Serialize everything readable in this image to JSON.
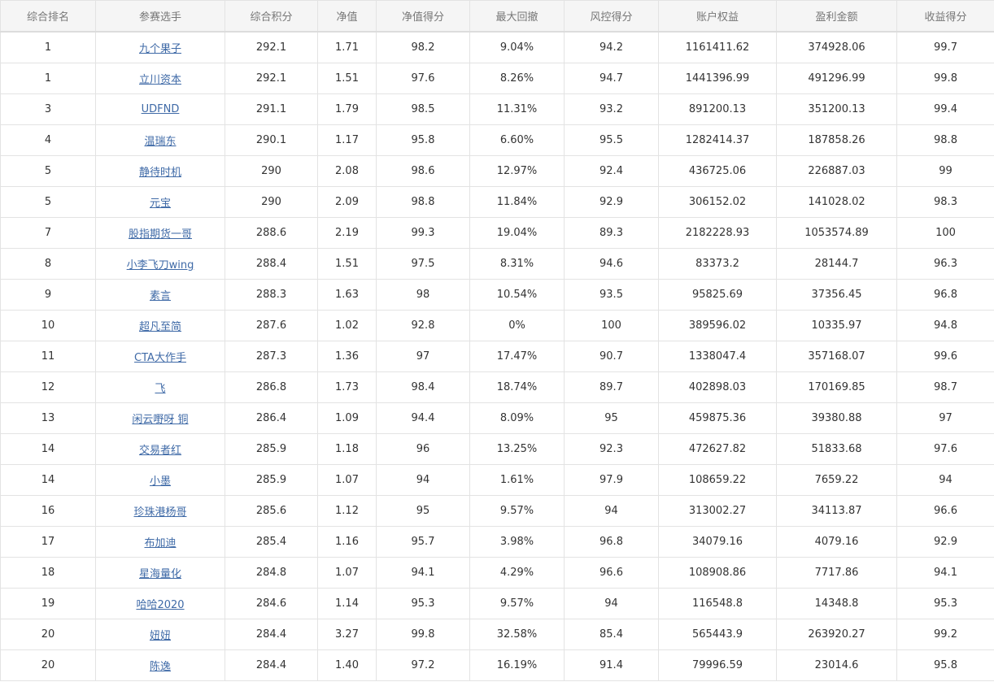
{
  "table": {
    "headers": [
      "综合排名",
      "参赛选手",
      "综合积分",
      "净值",
      "净值得分",
      "最大回撤",
      "风控得分",
      "账户权益",
      "盈利金额",
      "收益得分"
    ],
    "rows": [
      [
        "1",
        "九个果子",
        "292.1",
        "1.71",
        "98.2",
        "9.04%",
        "94.2",
        "1161411.62",
        "374928.06",
        "99.7"
      ],
      [
        "1",
        "立川资本",
        "292.1",
        "1.51",
        "97.6",
        "8.26%",
        "94.7",
        "1441396.99",
        "491296.99",
        "99.8"
      ],
      [
        "3",
        "UDFND",
        "291.1",
        "1.79",
        "98.5",
        "11.31%",
        "93.2",
        "891200.13",
        "351200.13",
        "99.4"
      ],
      [
        "4",
        "温瑞东",
        "290.1",
        "1.17",
        "95.8",
        "6.60%",
        "95.5",
        "1282414.37",
        "187858.26",
        "98.8"
      ],
      [
        "5",
        "静待时机",
        "290",
        "2.08",
        "98.6",
        "12.97%",
        "92.4",
        "436725.06",
        "226887.03",
        "99"
      ],
      [
        "5",
        "元宝",
        "290",
        "2.09",
        "98.8",
        "11.84%",
        "92.9",
        "306152.02",
        "141028.02",
        "98.3"
      ],
      [
        "7",
        "股指期货一哥",
        "288.6",
        "2.19",
        "99.3",
        "19.04%",
        "89.3",
        "2182228.93",
        "1053574.89",
        "100"
      ],
      [
        "8",
        "小李飞刀wing",
        "288.4",
        "1.51",
        "97.5",
        "8.31%",
        "94.6",
        "83373.2",
        "28144.7",
        "96.3"
      ],
      [
        "9",
        "素言",
        "288.3",
        "1.63",
        "98",
        "10.54%",
        "93.5",
        "95825.69",
        "37356.45",
        "96.8"
      ],
      [
        "10",
        "超凡至简",
        "287.6",
        "1.02",
        "92.8",
        "0%",
        "100",
        "389596.02",
        "10335.97",
        "94.8"
      ],
      [
        "11",
        "CTA大作手",
        "287.3",
        "1.36",
        "97",
        "17.47%",
        "90.7",
        "1338047.4",
        "357168.07",
        "99.6"
      ],
      [
        "12",
        "飞",
        "286.8",
        "1.73",
        "98.4",
        "18.74%",
        "89.7",
        "402898.03",
        "170169.85",
        "98.7"
      ],
      [
        "13",
        "闲云嘢呀 铜",
        "286.4",
        "1.09",
        "94.4",
        "8.09%",
        "95",
        "459875.36",
        "39380.88",
        "97"
      ],
      [
        "14",
        "交易者红",
        "285.9",
        "1.18",
        "96",
        "13.25%",
        "92.3",
        "472627.82",
        "51833.68",
        "97.6"
      ],
      [
        "14",
        "小墨",
        "285.9",
        "1.07",
        "94",
        "1.61%",
        "97.9",
        "108659.22",
        "7659.22",
        "94"
      ],
      [
        "16",
        "珍珠港杨哥",
        "285.6",
        "1.12",
        "95",
        "9.57%",
        "94",
        "313002.27",
        "34113.87",
        "96.6"
      ],
      [
        "17",
        "布加迪",
        "285.4",
        "1.16",
        "95.7",
        "3.98%",
        "96.8",
        "34079.16",
        "4079.16",
        "92.9"
      ],
      [
        "18",
        "星海量化",
        "284.8",
        "1.07",
        "94.1",
        "4.29%",
        "96.6",
        "108908.86",
        "7717.86",
        "94.1"
      ],
      [
        "19",
        "哈哈2020",
        "284.6",
        "1.14",
        "95.3",
        "9.57%",
        "94",
        "116548.8",
        "14348.8",
        "95.3"
      ],
      [
        "20",
        "妞妞",
        "284.4",
        "3.27",
        "99.8",
        "32.58%",
        "85.4",
        "565443.9",
        "263920.27",
        "99.2"
      ],
      [
        "20",
        "陈逸",
        "284.4",
        "1.40",
        "97.2",
        "16.19%",
        "91.4",
        "79996.59",
        "23014.6",
        "95.8"
      ]
    ]
  },
  "colors": {
    "link": "#3f6aa7",
    "header_bg": "#f5f5f5",
    "border": "#e3e3e3"
  }
}
